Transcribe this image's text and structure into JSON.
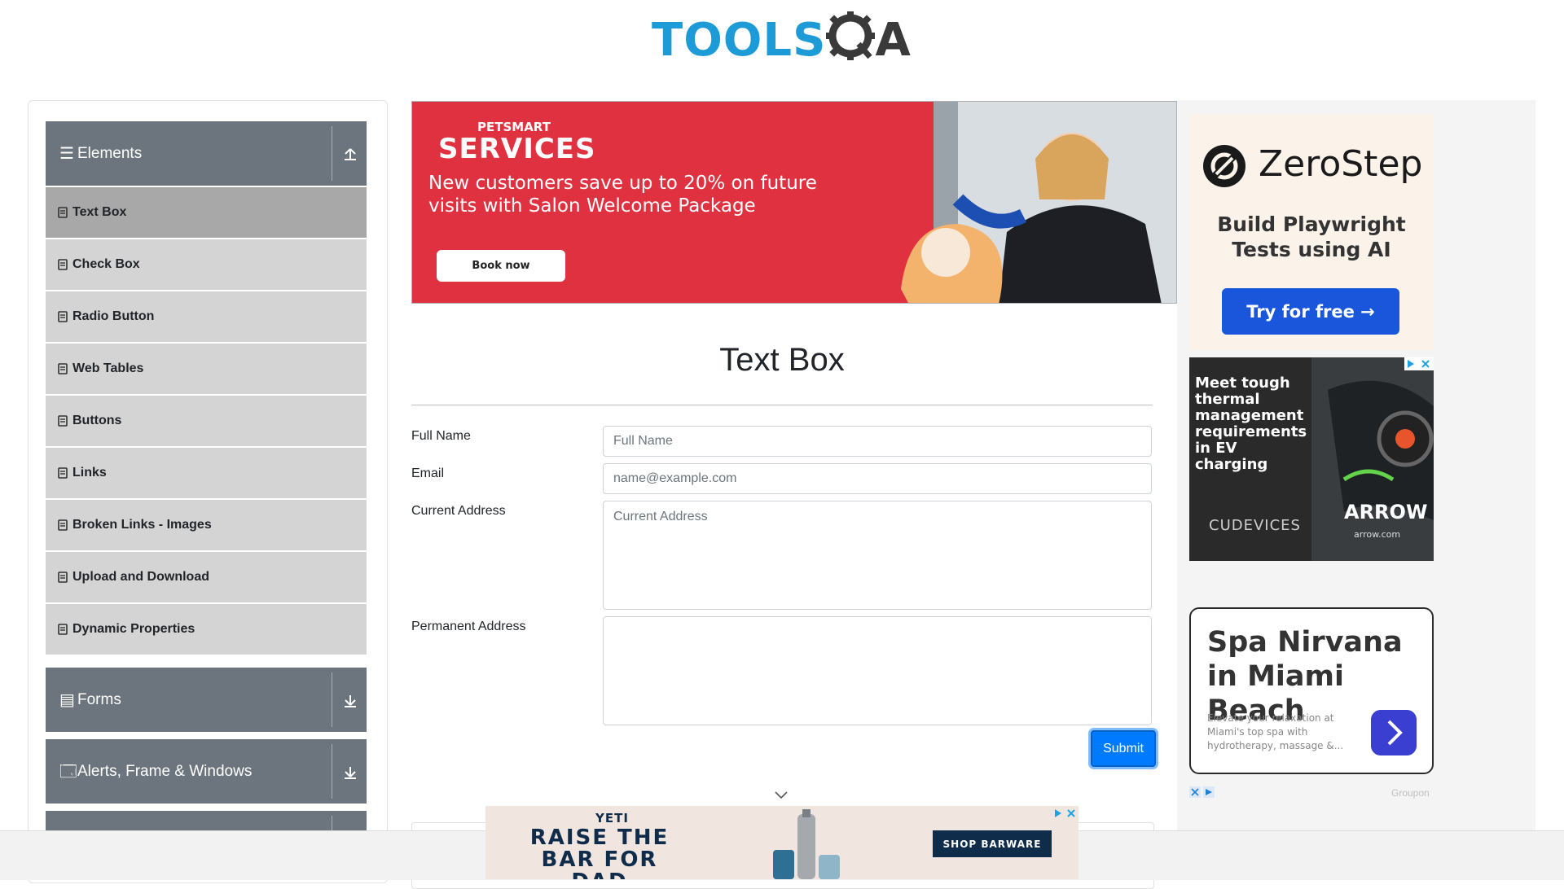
{
  "header": {
    "logo_tools": "TOOLS",
    "logo_qa": "QA"
  },
  "sidebar": {
    "groups": [
      {
        "label": "Elements",
        "icon": "menu-icon",
        "expanded": true
      },
      {
        "label": "Forms",
        "icon": "document-icon",
        "expanded": false
      },
      {
        "label": "Alerts, Frame & Windows",
        "icon": "window-icon",
        "expanded": false
      }
    ],
    "items": [
      {
        "label": "Text Box",
        "active": true
      },
      {
        "label": "Check Box"
      },
      {
        "label": "Radio Button"
      },
      {
        "label": "Web Tables"
      },
      {
        "label": "Buttons"
      },
      {
        "label": "Links"
      },
      {
        "label": "Broken Links - Images"
      },
      {
        "label": "Upload and Download"
      },
      {
        "label": "Dynamic Properties"
      }
    ]
  },
  "ads": {
    "petsmart": {
      "logo": "PETSMART",
      "services": "SERVICES",
      "copy": "New customers save up to 20% on future visits with Salon Welcome Package",
      "button": "Book now"
    },
    "zerostep": {
      "brand": "ZeroStep",
      "subtitle": "Build Playwright Tests using AI",
      "button": "Try for free →"
    },
    "arrow": {
      "copy": "Meet tough thermal management requirements in EV charging",
      "partner": "CUDEVICES",
      "brand": "ARROW",
      "url": "arrow.com"
    },
    "spa": {
      "title": "Spa Nirvana in Miami Beach",
      "description": "Elevate your relaxation at Miami's top spa with hydrotherapy, massage &...",
      "source": "Groupon"
    },
    "yeti": {
      "brand": "YETI",
      "headline": "RAISE THE BAR FOR DAD",
      "button": "SHOP BARWARE"
    }
  },
  "form": {
    "title": "Text Box",
    "full_name": {
      "label": "Full Name",
      "placeholder": "Full Name",
      "value": ""
    },
    "email": {
      "label": "Email",
      "placeholder": "name@example.com",
      "value": ""
    },
    "current_address": {
      "label": "Current Address",
      "placeholder": "Current Address",
      "value": ""
    },
    "permanent_address": {
      "label": "Permanent Address",
      "placeholder": "",
      "value": ""
    },
    "submit": "Submit"
  },
  "colors": {
    "primary": "#007bff",
    "sidebar_header": "#6c757d",
    "sidebar_item": "#d4d4d4",
    "sidebar_active": "#a8a8a8",
    "logo_blue": "#1d9bd7",
    "petsmart_red": "#e03140"
  }
}
